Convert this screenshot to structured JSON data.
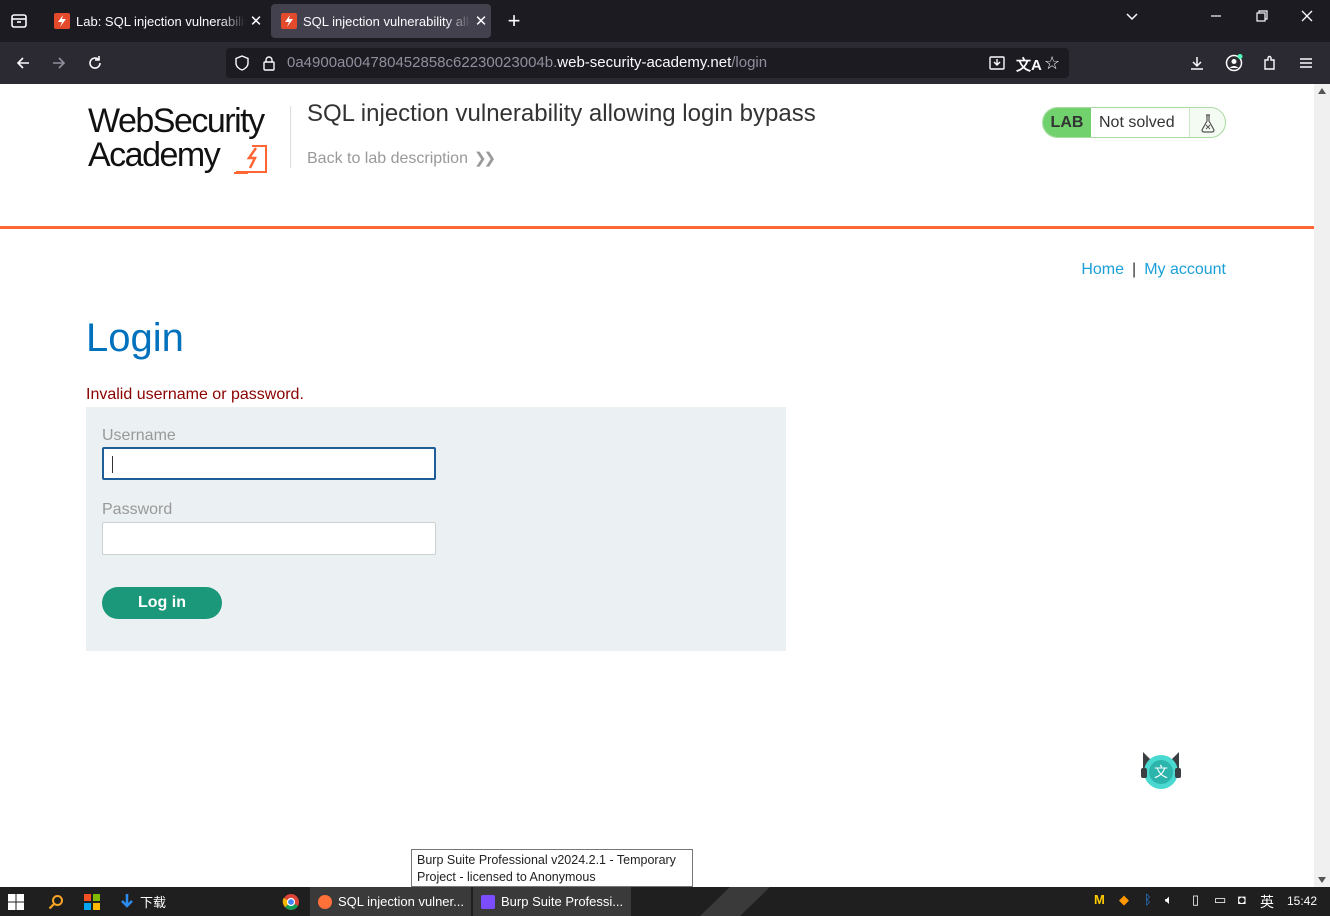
{
  "browser": {
    "tabs": [
      {
        "title": "Lab: SQL injection vulnerability allowing login bypass",
        "active": false
      },
      {
        "title": "SQL injection vulnerability allowing login bypass",
        "active": true
      }
    ],
    "url_prefix": "0a4900a004780452858c62230023004b.",
    "url_host": "web-security-academy.net",
    "url_path": "/login"
  },
  "header": {
    "logo_line1": "WebSecurity",
    "logo_line2": "Academy",
    "lab_title": "SQL injection vulnerability allowing login bypass",
    "back_link": "Back to lab description",
    "lab_badge": "LAB",
    "lab_status": "Not solved"
  },
  "nav": {
    "home": "Home",
    "separator": "|",
    "my_account": "My account"
  },
  "login": {
    "heading": "Login",
    "error": "Invalid username or password.",
    "username_label": "Username",
    "username_value": "",
    "password_label": "Password",
    "password_value": "",
    "submit": "Log in"
  },
  "tooltip": {
    "line1": "Burp Suite Professional v2024.2.1 - Temporary",
    "line2": "Project - licensed to Anonymous"
  },
  "taskbar": {
    "downloads": "下载",
    "app1": "SQL injection vulner...",
    "app2": "Burp Suite Professi...",
    "ime": "英",
    "clock": "15:42"
  },
  "colors": {
    "accent_orange": "#ff6633",
    "link_blue": "#1a9fd8",
    "heading_blue": "#0071bc",
    "button_green": "#1a9879",
    "lab_green": "#70d16d",
    "error_red": "#8b0000"
  }
}
